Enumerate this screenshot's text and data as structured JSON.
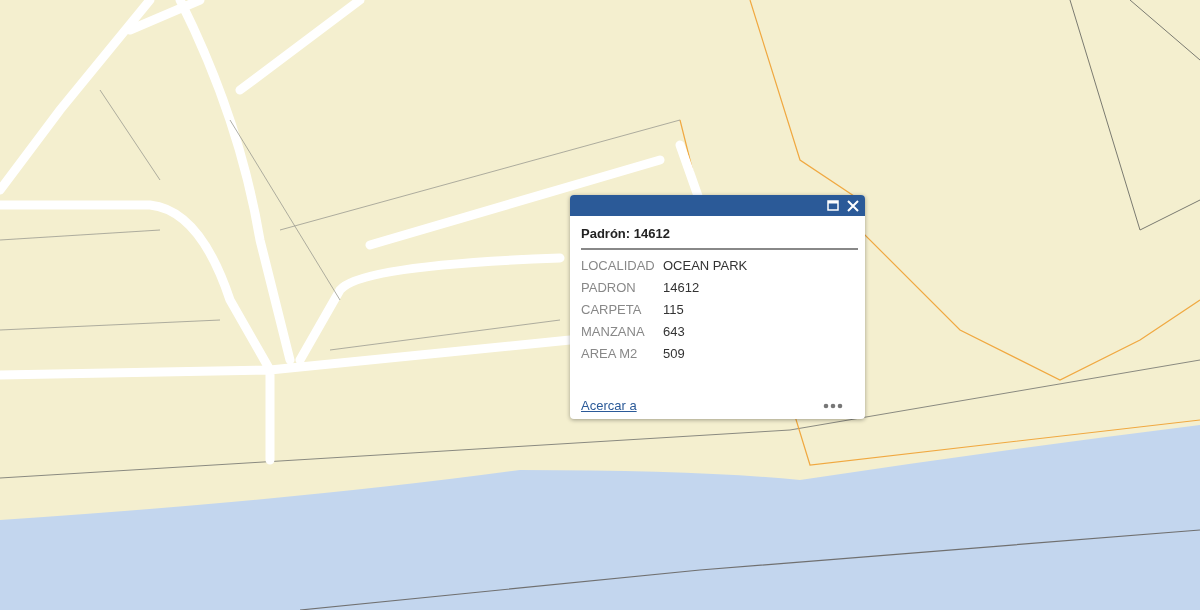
{
  "popup": {
    "title": "Padrón: 14612",
    "fields": [
      {
        "label": "LOCALIDAD",
        "value": "OCEAN PARK"
      },
      {
        "label": "PADRON",
        "value": "14612"
      },
      {
        "label": "CARPETA",
        "value": "115"
      },
      {
        "label": "MANZANA",
        "value": "643"
      },
      {
        "label": "AREA M2",
        "value": "509"
      }
    ],
    "link": "Acercar a"
  }
}
